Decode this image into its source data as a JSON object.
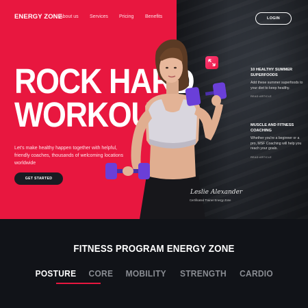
{
  "nav": {
    "logo": "ENERGY ZONE",
    "links": [
      "About us",
      "Services",
      "Pricing",
      "Benefits"
    ],
    "login": "LOGIN"
  },
  "hero": {
    "headline_line1": "ROCK HARD",
    "headline_line2": "WORKOUT",
    "description": "Let's make healthy happen together with helpful, friendly coaches, thousands of welcoming locations worldwide",
    "cta": "GET STARTED",
    "signature": "Leslie Alexander",
    "signature_caption": "Certificated Trainer Energy Zone"
  },
  "articles": [
    {
      "title": "10 HEALTHY SUMMER SUPERFOODS",
      "body": "Add these summer superfoods to your diet to keep healthy.",
      "read": "READ ARTICLE"
    },
    {
      "title": "MUSCLE AND FITNESS COACHING",
      "body": "Whether you're a beginner or a pro, MSF Coaching will help you reach your goals.",
      "read": "READ ARTICLE"
    }
  ],
  "program": {
    "title": "FITNESS PROGRAM ENERGY ZONE",
    "tabs": [
      "POSTURE",
      "CORE",
      "MOBILITY",
      "STRENGTH",
      "CARDIO"
    ],
    "active_tab": "POSTURE"
  },
  "colors": {
    "accent": "#e8173f",
    "dark": "#111318",
    "dumbbell": "#6a3fd8"
  },
  "icons": {
    "expand": "expand-arrows-icon"
  }
}
